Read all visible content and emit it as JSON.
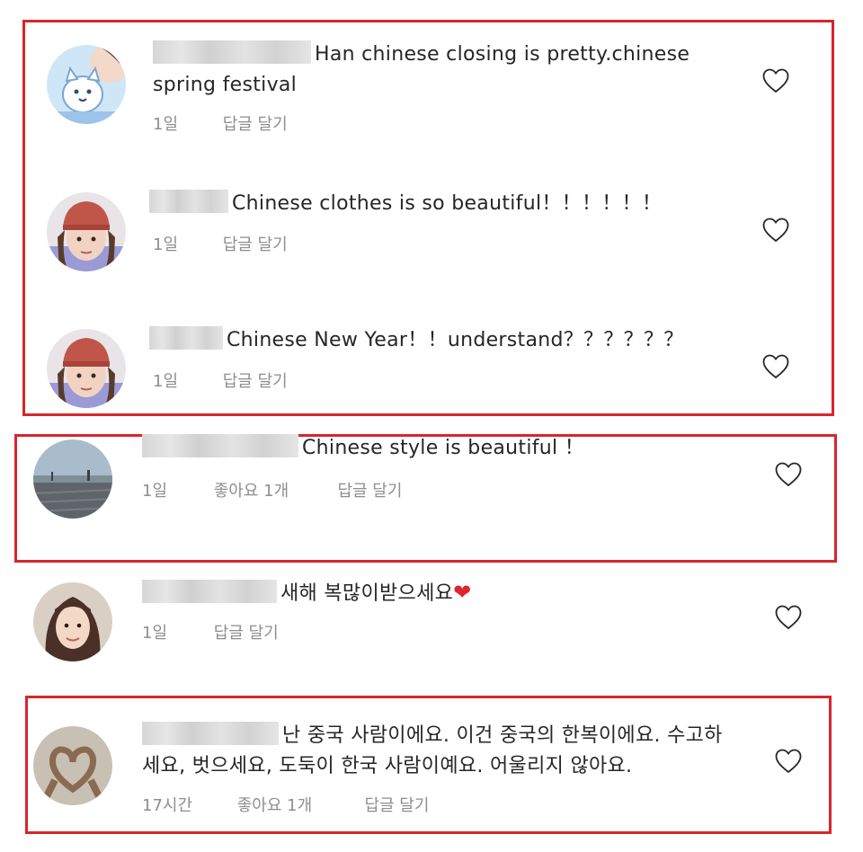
{
  "comments": [
    {
      "text": "Han chinese closing is pretty.chinese spring festival",
      "time": "1일",
      "reply": "답글 달기",
      "avatar": "avatar-cartoon-cat-icon"
    },
    {
      "text": "Chinese clothes is so beautiful！！！！！！",
      "time": "1일",
      "reply": "답글 달기",
      "avatar": "avatar-girl-red-cap-icon"
    },
    {
      "text": "Chinese New Year！！understand？？？？？？",
      "time": "1일",
      "reply": "답글 달기",
      "avatar": "avatar-girl-red-cap-icon"
    },
    {
      "text": "Chinese style is beautiful ！",
      "time": "1일",
      "likes": "좋아요 1개",
      "reply": "답글 달기",
      "avatar": "avatar-seaside-landscape-icon"
    },
    {
      "text": "새해 복많이받으세요",
      "emoji": "❤",
      "time": "1일",
      "reply": "답글 달기",
      "avatar": "avatar-woman-portrait-icon"
    },
    {
      "text": "난 중국 사람이에요. 이건 중국의 한복이에요. 수고하세요, 벗으세요, 도둑이 한국 사람이예요. 어울리지 않아요.",
      "time": "17시간",
      "likes": "좋아요 1개",
      "reply": "답글 달기",
      "avatar": "avatar-hand-heart-icon"
    }
  ],
  "colors": {
    "highlight_frame": "#d9252b",
    "meta_text": "#8e8e8e",
    "heart_emoji": "#e0242e"
  }
}
